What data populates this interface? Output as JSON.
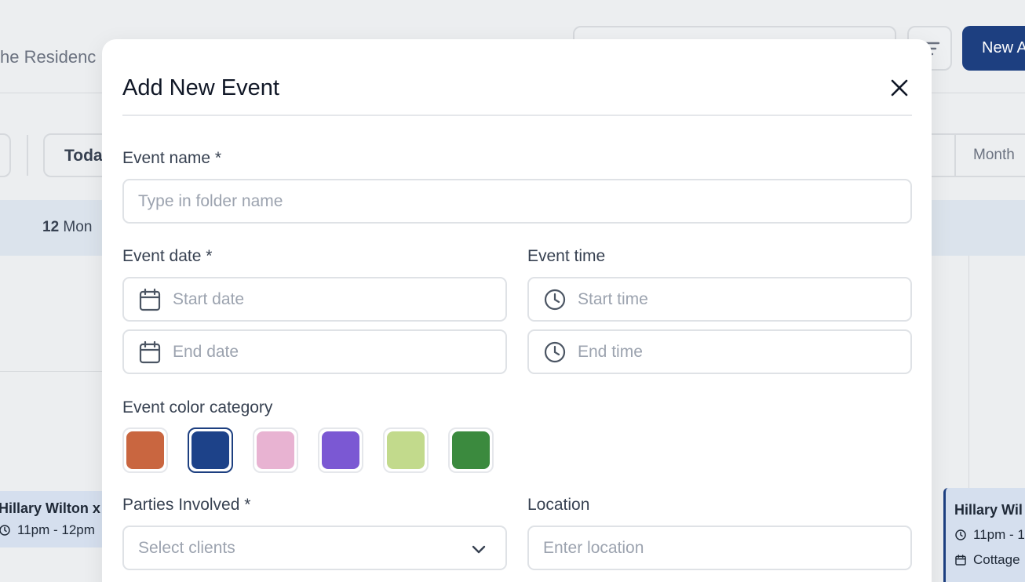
{
  "background": {
    "page_title": "he Residenc",
    "new_button_label": "New A",
    "today_button_label": "Toda",
    "view_month_label": "Month",
    "day_header": {
      "number": "12",
      "weekday": "Mon"
    },
    "event_left": {
      "name": "Hillary Wilton x",
      "time": "11pm - 12pm"
    },
    "event_right": {
      "name": "Hillary Wil",
      "time": "11pm - 1",
      "location": "Cottage"
    }
  },
  "modal": {
    "title": "Add New Event",
    "event_name": {
      "label": "Event name *",
      "placeholder": "Type in folder name",
      "value": ""
    },
    "event_date": {
      "label": "Event date *",
      "start_placeholder": "Start date",
      "end_placeholder": "End date"
    },
    "event_time": {
      "label": "Event time",
      "start_placeholder": "Start time",
      "end_placeholder": "End time"
    },
    "color_category": {
      "label": "Event color category",
      "colors": [
        "#c96640",
        "#1d4289",
        "#e8b3d2",
        "#7b58d3",
        "#c2da8c",
        "#3b8a3e"
      ],
      "selected_index": 1
    },
    "parties": {
      "label": "Parties Involved *",
      "placeholder": "Select clients"
    },
    "location": {
      "label": "Location",
      "placeholder": "Enter location"
    }
  },
  "icons": {
    "close": "close-icon",
    "calendar": "calendar-icon",
    "clock": "clock-icon",
    "chevron": "chevron-down-icon",
    "filter": "filter-icon"
  },
  "colors": {
    "primary": "#1d3f80",
    "event_bg": "#d5dfee",
    "page_bg": "#eceef0"
  }
}
